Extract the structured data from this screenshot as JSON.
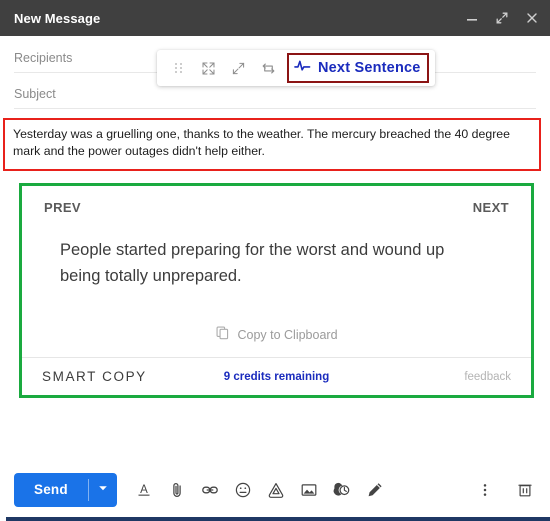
{
  "window": {
    "title": "New Message",
    "controls": [
      {
        "name": "minimize-button",
        "icon": "minimize-icon"
      },
      {
        "name": "fullscreen-button",
        "icon": "fullscreen-icon"
      },
      {
        "name": "close-button",
        "icon": "close-icon"
      }
    ]
  },
  "compose": {
    "recipients_label": "Recipients",
    "recipients_value": "",
    "subject_label": "Subject",
    "subject_value": "",
    "body_text": "Yesterday was a gruelling one, thanks to the weather. The mercury breached the 40 degree mark and the power outages didn't help either."
  },
  "ext_toolbar": {
    "drag_handle": "drag-handle-icon",
    "expand": "expand-icon",
    "collapse": "collapse-icon",
    "swap": "swap-icon",
    "pulse": "pulse-icon",
    "next_sentence_label": "Next Sentence",
    "highlight_color": "#8b1414",
    "accent_color": "#1a2bbd"
  },
  "suggestion_card": {
    "prev_label": "PREV",
    "next_label": "NEXT",
    "text": "People started preparing for the worst and wound up being totally unprepared.",
    "copy_label": "Copy to Clipboard",
    "copy_icon": "copy-icon",
    "brand_label": "SMART COPY",
    "credits_label": "9 credits remaining",
    "feedback_label": "feedback",
    "highlight_color": "#1aaa3f"
  },
  "bottom_bar": {
    "send_label": "Send",
    "send_color": "#1a73e8",
    "send_options_icon": "chevron-down-icon",
    "tools": [
      {
        "name": "format-text-icon",
        "title": "Formatting options"
      },
      {
        "name": "attach-file-icon",
        "title": "Attach files"
      },
      {
        "name": "insert-link-icon",
        "title": "Insert link"
      },
      {
        "name": "insert-emoji-icon",
        "title": "Insert emoji"
      },
      {
        "name": "insert-drive-icon",
        "title": "Insert files using Drive"
      },
      {
        "name": "insert-photo-icon",
        "title": "Insert photo"
      },
      {
        "name": "confidential-mode-icon",
        "title": "Toggle confidential mode"
      },
      {
        "name": "insert-signature-icon",
        "title": "Insert signature"
      }
    ],
    "more_options_icon": "more-options-icon",
    "discard_icon": "trash-icon"
  },
  "highlights": {
    "body_box_color": "#e8211b",
    "card_box_color": "#1aaa3f",
    "button_box_color": "#8b1414"
  }
}
